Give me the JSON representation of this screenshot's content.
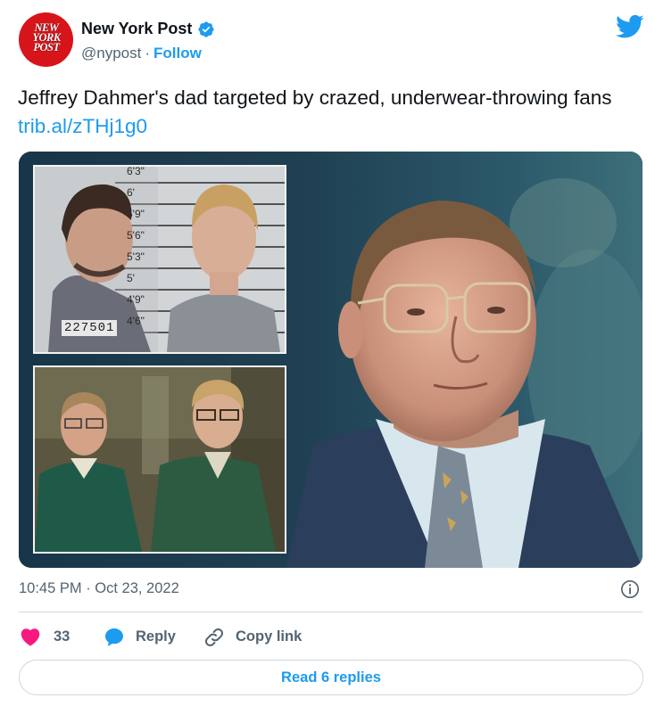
{
  "account": {
    "name": "New York Post",
    "handle": "@nypost",
    "separator": "·",
    "follow_label": "Follow",
    "logo_lines": [
      "NEW",
      "YORK",
      "POST"
    ],
    "brand_color": "#d7141a",
    "verified_color": "#1d9bf0"
  },
  "tweet": {
    "text": "Jeffrey Dahmer's dad targeted by crazed, underwear-throwing fans",
    "link": "trib.al/zTHj1g0",
    "timestamp": "10:45 PM · Oct 23, 2022"
  },
  "media": {
    "mugshot_number": "227501",
    "height_marks": [
      "6'3\"",
      "6'",
      "5'9\"",
      "5'6\"",
      "5'3\"",
      "5'",
      "4'9\"",
      "4'6\""
    ]
  },
  "actions": {
    "like_count": "33",
    "reply_label": "Reply",
    "copy_link_label": "Copy link",
    "read_replies_label": "Read 6 replies"
  },
  "colors": {
    "accent": "#1d9bf0",
    "heart": "#f91880",
    "secondary_text": "#536471",
    "divider": "#cfd9de"
  },
  "icons": [
    "verified-badge-icon",
    "twitter-bird-icon",
    "info-icon",
    "heart-icon",
    "reply-bubble-icon",
    "link-icon"
  ]
}
